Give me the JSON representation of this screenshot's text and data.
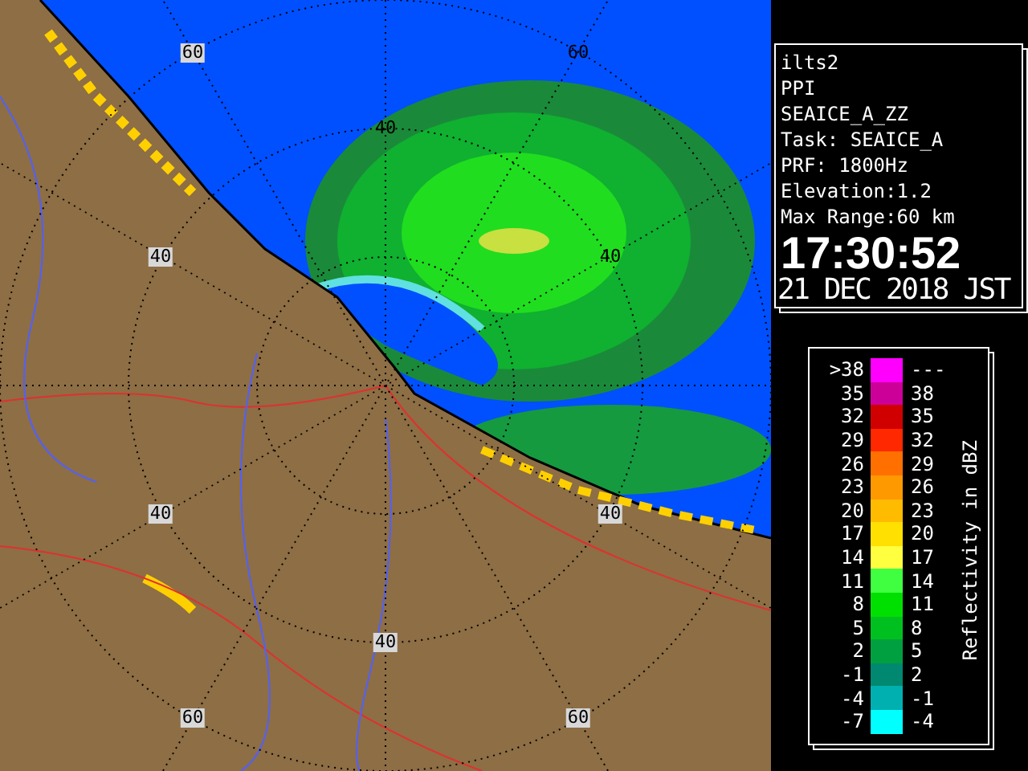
{
  "map": {
    "range_labels": [
      {
        "text": "60",
        "boxed": true
      },
      {
        "text": "60",
        "boxed": false
      },
      {
        "text": "40",
        "boxed": false
      },
      {
        "text": "40",
        "boxed": true
      },
      {
        "text": "40",
        "boxed": false
      },
      {
        "text": "40",
        "boxed": true
      },
      {
        "text": "40",
        "boxed": true
      },
      {
        "text": "40",
        "boxed": true
      },
      {
        "text": "60",
        "boxed": true
      },
      {
        "text": "60",
        "boxed": true
      }
    ]
  },
  "info": {
    "lines": [
      "ilts2",
      "PPI",
      "SEAICE_A_ZZ",
      "Task: SEAICE_A",
      "PRF: 1800Hz",
      "Elevation:1.2",
      "Max Range:60 km"
    ],
    "time": "17:30:52",
    "date": "21 DEC 2018 JST"
  },
  "legend": {
    "title": "Reflectivity in dBZ",
    "rows": [
      {
        "low": ">38",
        "high": "---",
        "color": "#ff00ff"
      },
      {
        "low": "35",
        "high": "38",
        "color": "#cc0099"
      },
      {
        "low": "32",
        "high": "35",
        "color": "#d00000"
      },
      {
        "low": "29",
        "high": "32",
        "color": "#ff2800"
      },
      {
        "low": "26",
        "high": "29",
        "color": "#ff7000"
      },
      {
        "low": "23",
        "high": "26",
        "color": "#ff9900"
      },
      {
        "low": "20",
        "high": "23",
        "color": "#ffbb00"
      },
      {
        "low": "17",
        "high": "20",
        "color": "#ffe000"
      },
      {
        "low": "14",
        "high": "17",
        "color": "#ffff40"
      },
      {
        "low": "11",
        "high": "14",
        "color": "#40ff40"
      },
      {
        "low": "8",
        "high": "11",
        "color": "#00e000"
      },
      {
        "low": "5",
        "high": "8",
        "color": "#00c020"
      },
      {
        "low": "2",
        "high": "5",
        "color": "#00a040"
      },
      {
        "low": "-1",
        "high": "2",
        "color": "#008870"
      },
      {
        "low": "-4",
        "high": "-1",
        "color": "#00b0b0"
      },
      {
        "low": "-7",
        "high": "-4",
        "color": "#00ffff"
      }
    ]
  }
}
